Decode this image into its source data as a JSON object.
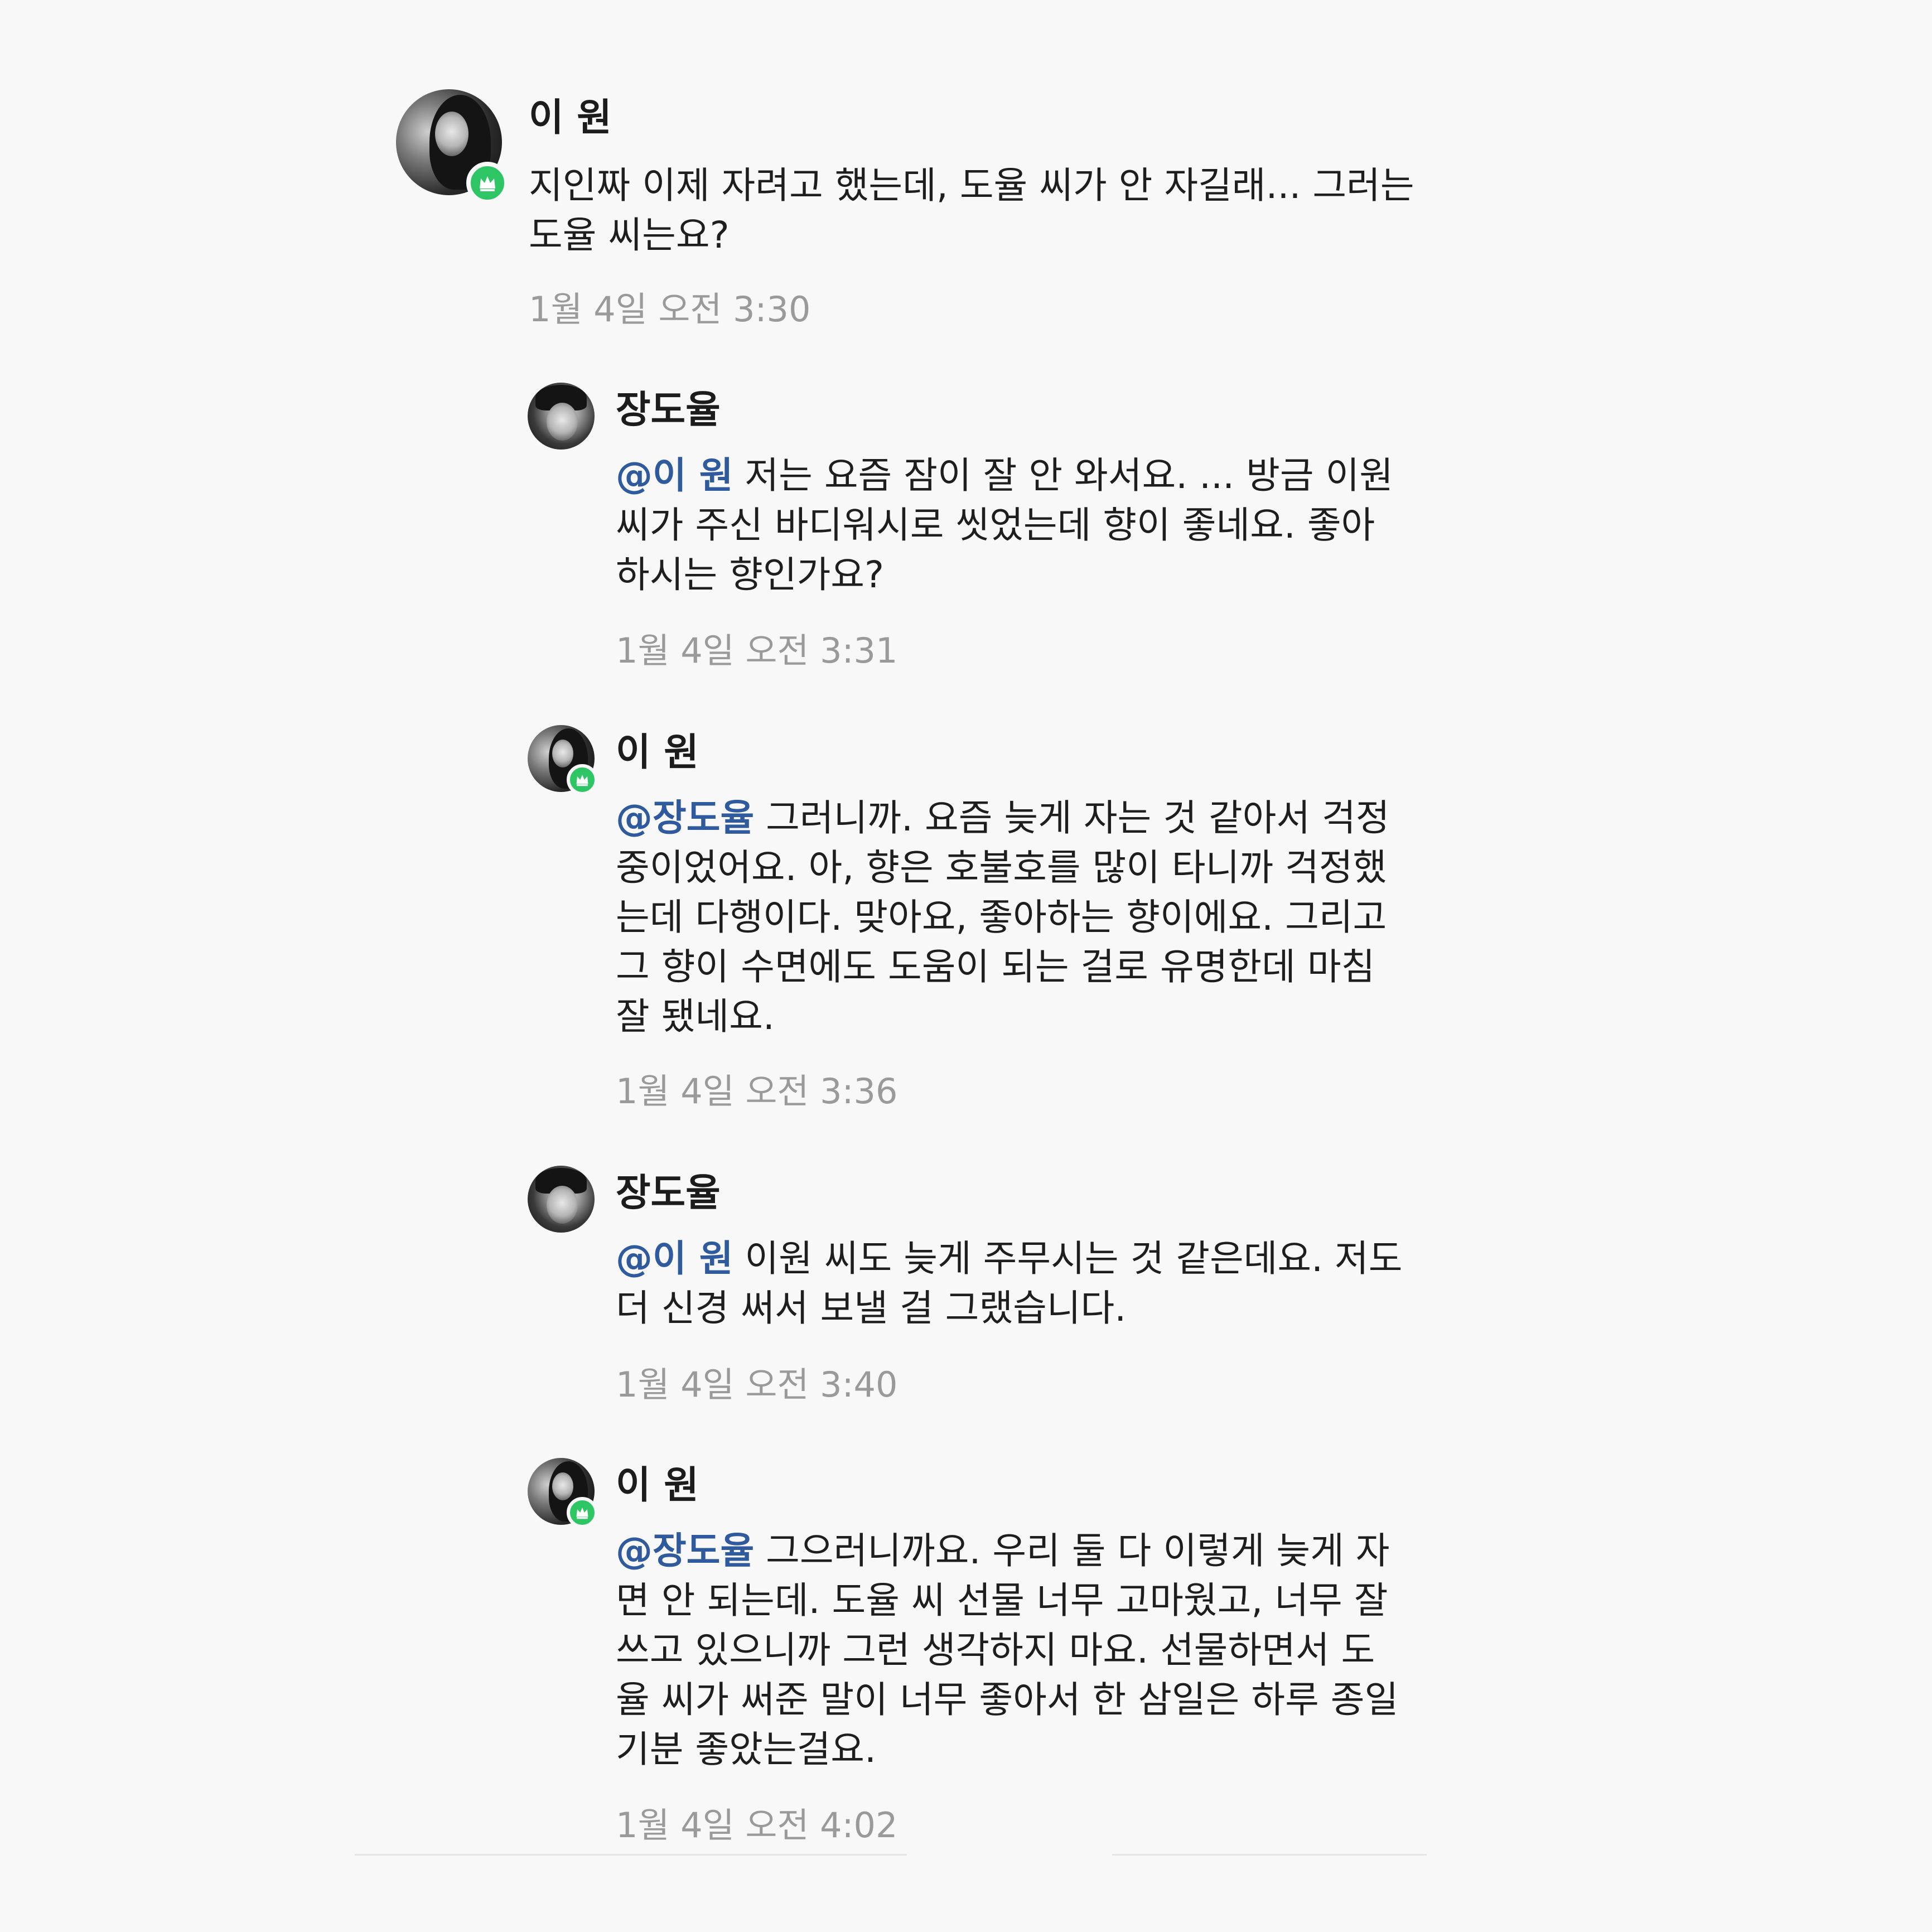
{
  "comments": [
    {
      "author": "이 원",
      "mention": "",
      "text": "지인짜 이제 자려고 했는데, 도율 씨가 안 자길래... 그러는\n도율 씨는요?",
      "time": "1월 4일 오전 3:30",
      "badge": "crown-icon"
    },
    {
      "author": "장도율",
      "mention": "@이 원",
      "text": " 저는 요즘 잠이 잘 안 와서요. ... 방금 이원\n씨가 주신 바디워시로 씻었는데 향이 좋네요. 좋아\n하시는 향인가요?",
      "time": "1월 4일 오전 3:31",
      "badge": ""
    },
    {
      "author": "이 원",
      "mention": "@장도율",
      "text": " 그러니까. 요즘 늦게 자는 것 같아서 걱정\n중이었어요. 아, 향은 호불호를 많이 타니까 걱정했\n는데 다행이다. 맞아요, 좋아하는 향이에요. 그리고\n그 향이 수면에도 도움이 되는 걸로 유명한데 마침\n잘 됐네요.",
      "time": "1월 4일 오전 3:36",
      "badge": "crown-icon"
    },
    {
      "author": "장도율",
      "mention": "@이 원",
      "text": " 이원 씨도 늦게 주무시는 것 같은데요. 저도\n더 신경 써서 보낼 걸 그랬습니다.",
      "time": "1월 4일 오전 3:40",
      "badge": ""
    },
    {
      "author": "이 원",
      "mention": "@장도율",
      "text": " 그으러니까요. 우리 둘 다 이렇게 늦게 자\n면 안 되는데. 도율 씨 선물 너무 고마웠고, 너무 잘\n쓰고 있으니까 그런 생각하지 마요. 선물하면서 도\n율 씨가 써준 말이 너무 좋아서 한 삼일은 하루 종일\n기분 좋았는걸요.",
      "time": "1월 4일 오전 4:02",
      "badge": "crown-icon"
    }
  ],
  "colors": {
    "background": "#f8f8f8",
    "mention": "#2f5a9e",
    "badge": "#2ec565",
    "timestamp": "#9a9a9a"
  }
}
